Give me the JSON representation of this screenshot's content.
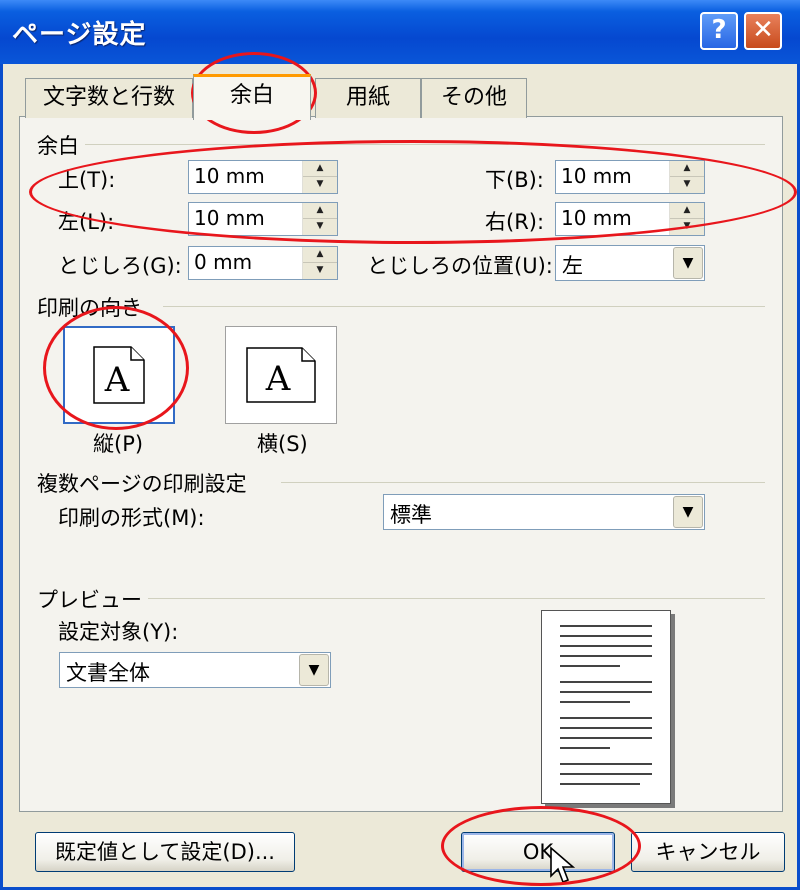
{
  "window": {
    "title": "ページ設定",
    "help_label": "?",
    "close_label": "✕"
  },
  "tabs": [
    {
      "label": "文字数と行数",
      "active": false
    },
    {
      "label": "余白",
      "active": true
    },
    {
      "label": "用紙",
      "active": false
    },
    {
      "label": "その他",
      "active": false
    }
  ],
  "margins": {
    "group_label": "余白",
    "top_label": "上(T):",
    "top_value": "10 mm",
    "bottom_label": "下(B):",
    "bottom_value": "10 mm",
    "left_label": "左(L):",
    "left_value": "10 mm",
    "right_label": "右(R):",
    "right_value": "10 mm",
    "gutter_label": "とじしろ(G):",
    "gutter_value": "0 mm",
    "gutter_pos_label": "とじしろの位置(U):",
    "gutter_pos_value": "左"
  },
  "orientation": {
    "group_label": "印刷の向き",
    "portrait_label": "縦(P)",
    "landscape_label": "横(S)",
    "icon_letter": "A",
    "selected": "portrait"
  },
  "multipage": {
    "group_label": "複数ページの印刷設定",
    "format_label": "印刷の形式(M):",
    "format_value": "標準"
  },
  "preview": {
    "group_label": "プレビュー",
    "apply_label": "設定対象(Y):",
    "apply_value": "文書全体"
  },
  "buttons": {
    "default_label": "既定値として設定(D)...",
    "ok_label": "OK",
    "cancel_label": "キャンセル"
  },
  "colors": {
    "titlebar": "#0548d0",
    "face": "#ece9d8",
    "annotation": "#e8161c",
    "tab_highlight": "#ff9a00",
    "selection": "#316ac5"
  }
}
